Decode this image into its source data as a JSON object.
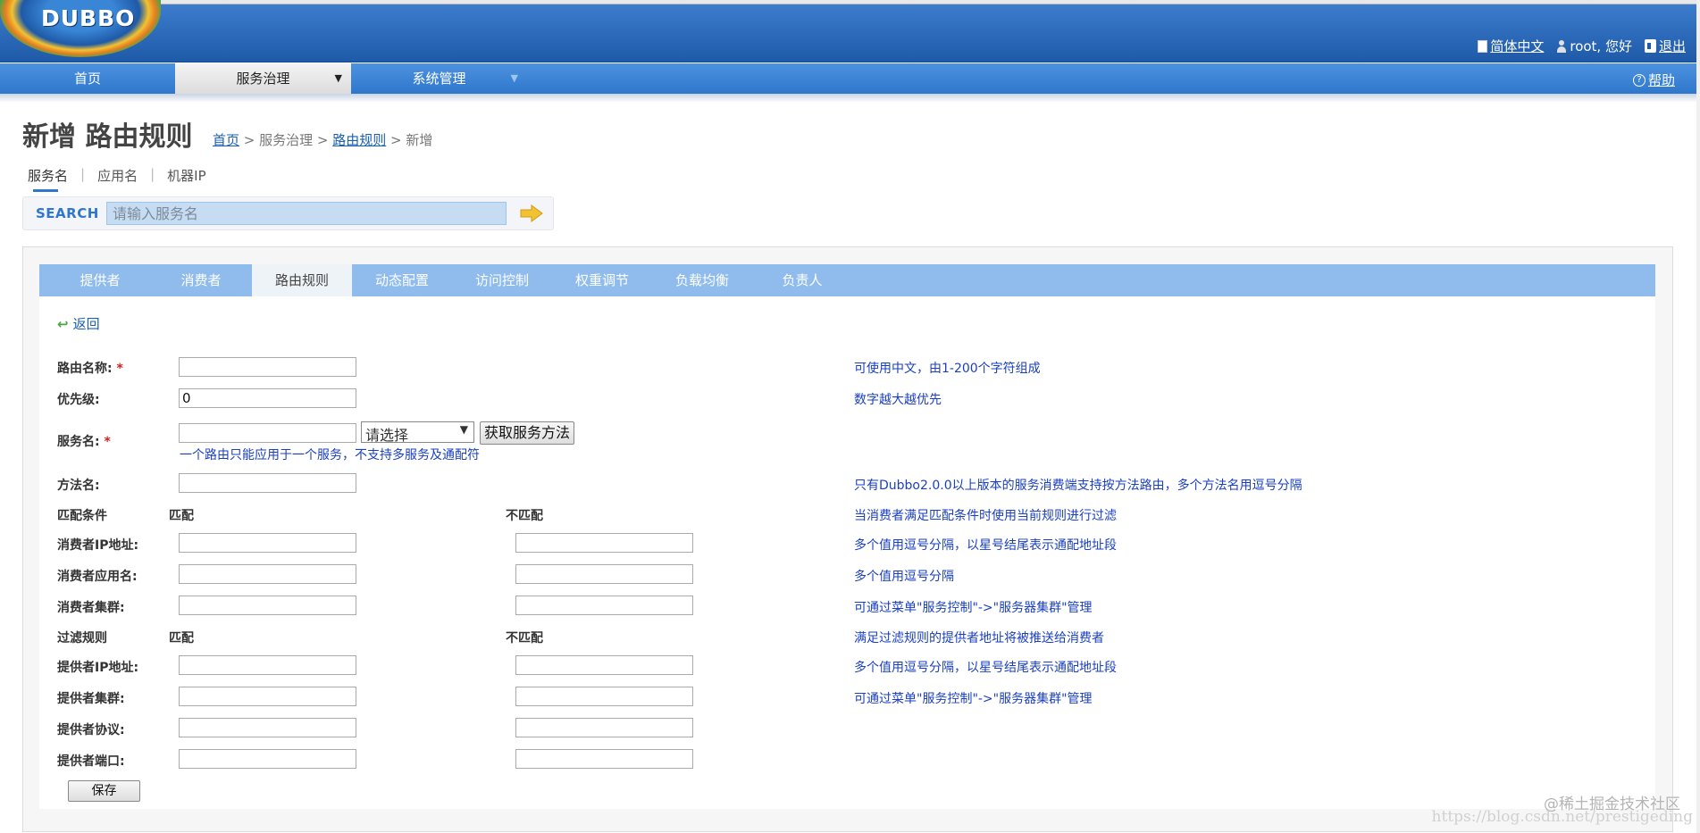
{
  "header": {
    "logo": "DUBBO",
    "lang_link": "简体中文",
    "user_greeting": "root, 您好",
    "logout": "退出"
  },
  "nav": {
    "items": [
      {
        "label": "首页"
      },
      {
        "label": "服务治理",
        "caret": "▼"
      },
      {
        "label": "系统管理",
        "caret": "▼"
      }
    ],
    "help": "帮助"
  },
  "page": {
    "title": "新增 路由规则",
    "breadcrumb": {
      "home": "首页",
      "sep1": " > ",
      "section": "服务治理",
      "sep2": " > ",
      "routes": "路由规则",
      "sep3": " > ",
      "current": "新增"
    }
  },
  "search": {
    "tabs": [
      {
        "label": "服务名",
        "active": true
      },
      {
        "label": "应用名"
      },
      {
        "label": "机器IP"
      }
    ],
    "separator": "|",
    "label": "SEARCH",
    "placeholder": "请输入服务名",
    "go_icon": "arrow-right-icon",
    "go_color": "#f1c232"
  },
  "tabs": [
    {
      "label": "提供者"
    },
    {
      "label": "消费者"
    },
    {
      "label": "路由规则",
      "active": true
    },
    {
      "label": "动态配置"
    },
    {
      "label": "访问控制"
    },
    {
      "label": "权重调节"
    },
    {
      "label": "负载均衡"
    },
    {
      "label": "负责人"
    }
  ],
  "back": "返回",
  "form": {
    "route_name": {
      "label": "路由名称:",
      "required": "*",
      "value": "",
      "hint": "可使用中文，由1-200个字符组成"
    },
    "priority": {
      "label": "优先级:",
      "value": "0",
      "hint": "数字越大越优先"
    },
    "service": {
      "label": "服务名:",
      "required": "*",
      "value": "",
      "select_value": "请选择",
      "fetch_button": "获取服务方法",
      "note": "一个路由只能应用于一个服务，不支持多服务及通配符"
    },
    "method": {
      "label": "方法名:",
      "value": "",
      "hint": "只有Dubbo2.0.0以上版本的服务消费端支持按方法路由，多个方法名用逗号分隔"
    },
    "match_section": {
      "label": "匹配条件",
      "match": "匹配",
      "mismatch": "不匹配",
      "hint": "当消费者满足匹配条件时使用当前规则进行过滤"
    },
    "consumer_ip": {
      "label": "消费者IP地址:",
      "hint": "多个值用逗号分隔，以星号结尾表示通配地址段"
    },
    "consumer_app": {
      "label": "消费者应用名:",
      "hint": "多个值用逗号分隔"
    },
    "consumer_cluster": {
      "label": "消费者集群:",
      "hint": "可通过菜单\"服务控制\"->\"服务器集群\"管理"
    },
    "filter_section": {
      "label": "过滤规则",
      "match": "匹配",
      "mismatch": "不匹配",
      "hint": "满足过滤规则的提供者地址将被推送给消费者"
    },
    "provider_ip": {
      "label": "提供者IP地址:",
      "hint": "多个值用逗号分隔，以星号结尾表示通配地址段"
    },
    "provider_cluster": {
      "label": "提供者集群:",
      "hint": "可通过菜单\"服务控制\"->\"服务器集群\"管理"
    },
    "provider_protocol": {
      "label": "提供者协议:"
    },
    "provider_port": {
      "label": "提供者端口:"
    },
    "save": "保存"
  },
  "watermark": {
    "line1": "@稀土掘金技术社区",
    "line2": "https://blog.csdn.net/prestigeding"
  }
}
